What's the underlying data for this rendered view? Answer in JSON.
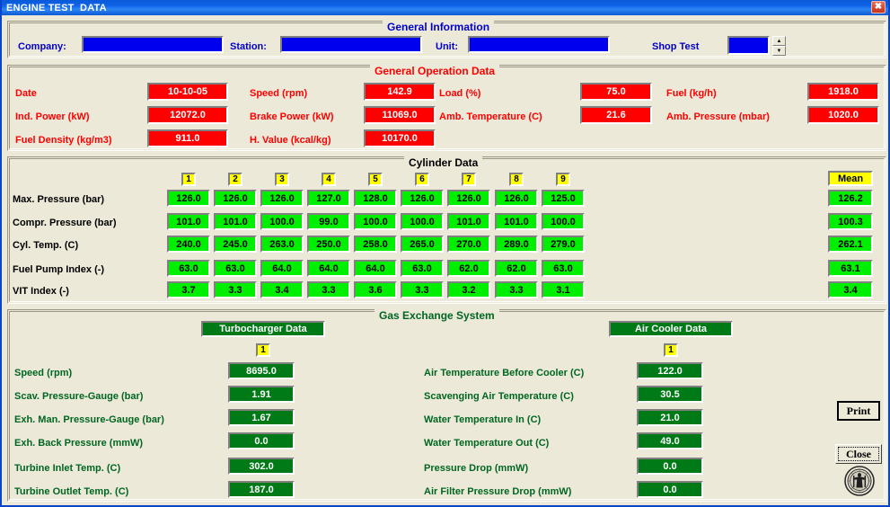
{
  "window": {
    "title": "ENGINE TEST  DATA",
    "close_icon": "close-icon",
    "close_glyph": "✖"
  },
  "general_information": {
    "legend": "General Information",
    "fields": [
      {
        "label": "Company:",
        "value": ""
      },
      {
        "label": "Station:",
        "value": ""
      },
      {
        "label": "Unit:",
        "value": ""
      },
      {
        "label": "Shop Test",
        "value": ""
      }
    ],
    "spinner_up": "▲",
    "spinner_down": "▼"
  },
  "general_operation_data": {
    "legend": "General Operation Data",
    "items": [
      {
        "label": "Date",
        "value": "10-10-05"
      },
      {
        "label": "Speed (rpm)",
        "value": "142.9"
      },
      {
        "label": "Load (%)",
        "value": "75.0"
      },
      {
        "label": "Fuel (kg/h)",
        "value": "1918.0"
      },
      {
        "label": "Ind. Power (kW)",
        "value": "12072.0"
      },
      {
        "label": "Brake Power (kW)",
        "value": "11069.0"
      },
      {
        "label": "Amb. Temperature (C)",
        "value": "21.6"
      },
      {
        "label": "Amb. Pressure (mbar)",
        "value": "1020.0"
      },
      {
        "label": "Fuel Density (kg/m3)",
        "value": "911.0"
      },
      {
        "label": "H. Value (kcal/kg)",
        "value": "10170.0"
      }
    ]
  },
  "cylinder_data": {
    "legend": "Cylinder Data",
    "columns": [
      "1",
      "2",
      "3",
      "4",
      "5",
      "6",
      "7",
      "8",
      "9"
    ],
    "mean_header": "Mean",
    "rows": [
      {
        "label": "Max. Pressure (bar)",
        "values": [
          "126.0",
          "126.0",
          "126.0",
          "127.0",
          "128.0",
          "126.0",
          "126.0",
          "126.0",
          "125.0"
        ],
        "mean": "126.2"
      },
      {
        "label": "Compr. Pressure (bar)",
        "values": [
          "101.0",
          "101.0",
          "100.0",
          "99.0",
          "100.0",
          "100.0",
          "101.0",
          "101.0",
          "100.0"
        ],
        "mean": "100.3"
      },
      {
        "label": "Cyl. Temp. (C)",
        "values": [
          "240.0",
          "245.0",
          "263.0",
          "250.0",
          "258.0",
          "265.0",
          "270.0",
          "289.0",
          "279.0"
        ],
        "mean": "262.1"
      },
      {
        "label": "Fuel Pump Index (-)",
        "values": [
          "63.0",
          "63.0",
          "64.0",
          "64.0",
          "64.0",
          "63.0",
          "62.0",
          "62.0",
          "63.0"
        ],
        "mean": "63.1"
      },
      {
        "label": "VIT Index (-)",
        "values": [
          "3.7",
          "3.3",
          "3.4",
          "3.3",
          "3.6",
          "3.3",
          "3.2",
          "3.3",
          "3.1"
        ],
        "mean": "3.4"
      }
    ]
  },
  "gas_exchange_system": {
    "legend": "Gas Exchange System",
    "turbocharger": {
      "header": "Turbocharger Data",
      "index": "1",
      "rows": [
        {
          "label": "Speed (rpm)",
          "value": "8695.0"
        },
        {
          "label": "Scav. Pressure-Gauge  (bar)",
          "value": "1.91"
        },
        {
          "label": "Exh. Man. Pressure-Gauge (bar)",
          "value": "1.67"
        },
        {
          "label": "Exh. Back Pressure (mmW)",
          "value": "0.0"
        },
        {
          "label": "Turbine Inlet Temp. (C)",
          "value": "302.0"
        },
        {
          "label": "Turbine Outlet Temp. (C)",
          "value": "187.0"
        }
      ]
    },
    "air_cooler": {
      "header": "Air Cooler Data",
      "index": "1",
      "rows": [
        {
          "label": "Air Temperature Before Cooler (C)",
          "value": "122.0"
        },
        {
          "label": "Scavenging Air Temperature (C)",
          "value": "30.5"
        },
        {
          "label": "Water Temperature In (C)",
          "value": "21.0"
        },
        {
          "label": "Water Temperature Out (C)",
          "value": "49.0"
        },
        {
          "label": "Pressure Drop (mmW)",
          "value": "0.0"
        },
        {
          "label": "Air Filter Pressure Drop (mmW)",
          "value": "0.0"
        }
      ]
    }
  },
  "actions": {
    "print_label": "Print",
    "close_label": "Close",
    "seal_name": "university-seal-logo"
  },
  "colors": {
    "titlebar": "#0E63E8",
    "window_bg": "#ECE9D8",
    "input_blue": "#0000EE",
    "operation_red": "#FF0000",
    "cylinder_green": "#00EE00",
    "gas_dark_green": "#007A16",
    "index_yellow": "#FFFF00"
  }
}
